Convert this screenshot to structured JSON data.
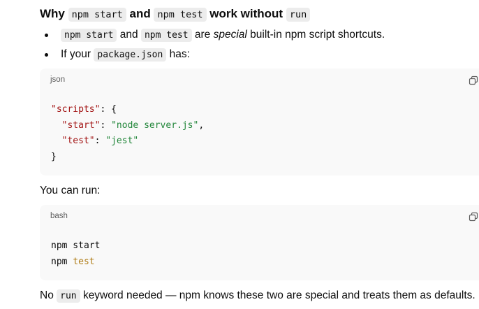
{
  "heading": {
    "t1": "Why",
    "c1": "npm start",
    "t2": "and",
    "c2": "npm test",
    "t3": "work without",
    "c3": "run"
  },
  "bullets": [
    {
      "c1": "npm start",
      "t1": "and",
      "c2": "npm test",
      "t2": "are",
      "em": "special",
      "t3": "built-in npm script shortcuts."
    },
    {
      "t1": "If your",
      "c1": "package.json",
      "t2": "has:"
    }
  ],
  "code_json": {
    "lang": "json",
    "copy_icon": "copy-icon",
    "lines": {
      "l1_key": "\"scripts\"",
      "l1_rest": ": {",
      "l2_key": "\"start\"",
      "l2_sep": ": ",
      "l2_val": "\"node server.js\"",
      "l2_end": ",",
      "l3_key": "\"test\"",
      "l3_sep": ": ",
      "l3_val": "\"jest\"",
      "l4": "}"
    }
  },
  "para_run": "You can run:",
  "code_bash": {
    "lang": "bash",
    "copy_icon": "copy-icon",
    "lines": {
      "l1": "npm start",
      "l2_cmd": "npm",
      "l2_arg": "test"
    }
  },
  "final": {
    "t1": "No",
    "c1": "run",
    "t2": "keyword needed — npm knows these two are special and treats them as defaults."
  }
}
